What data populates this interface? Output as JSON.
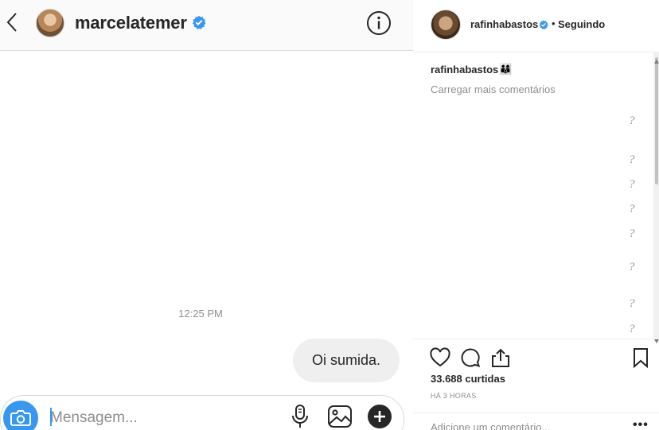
{
  "dm": {
    "username": "marcelatemer",
    "timestamp": "12:25 PM",
    "message": "Oi sumida.",
    "composer": {
      "placeholder": "Mensagem..."
    }
  },
  "post": {
    "username": "rafinhabastos",
    "separator": "•",
    "follow_label": "Seguindo",
    "caption_user": "rafinhabastos",
    "caption_emoji": "👨‍👩‍👦",
    "load_more": "Carregar mais comentários",
    "placeholder_glyphs": [
      "?",
      "?",
      "?",
      "?",
      "?",
      "?",
      "?",
      "?"
    ],
    "likes": "33.688 curtidas",
    "time_ago": "HÁ 3 HORAS",
    "comment_placeholder": "Adicione um comentário...",
    "more_label": "•••"
  },
  "colors": {
    "accent": "#3897f0",
    "text": "#262626",
    "muted": "#8e8e8e",
    "bubble": "#efefef",
    "border": "#dbdbdb"
  },
  "icons": [
    "back-chevron-icon",
    "verified-badge-icon",
    "info-icon",
    "camera-icon",
    "microphone-icon",
    "image-icon",
    "plus-icon",
    "heart-icon",
    "comment-icon",
    "share-icon",
    "bookmark-icon"
  ]
}
